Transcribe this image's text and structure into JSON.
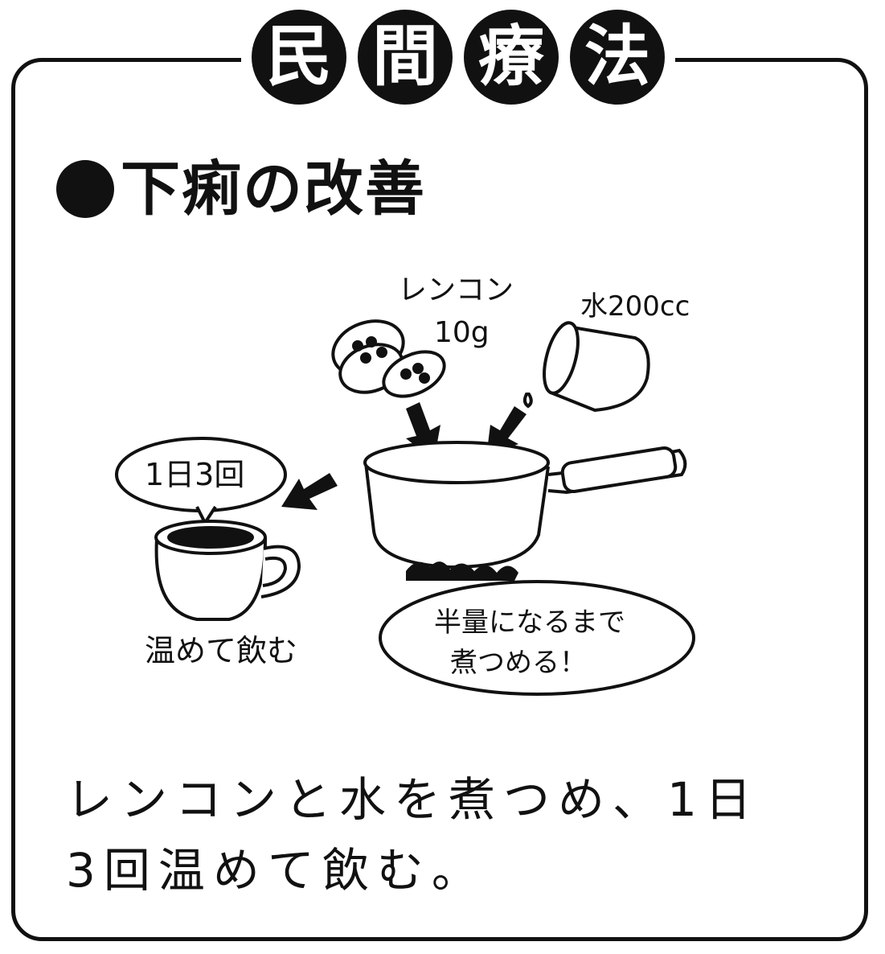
{
  "title": {
    "chars": [
      "民",
      "間",
      "療",
      "法"
    ]
  },
  "heading": "下痢の改善",
  "illustration": {
    "lotus_label": "レンコン",
    "lotus_amount": "10g",
    "water_label": "水200cc",
    "bubble_text": "1日3回",
    "cup_label": "温めて飲む",
    "pot_note_line1": "半量になるまで",
    "pot_note_line2": "煮つめる！"
  },
  "caption": {
    "line1": "レンコンと水を煮つめ、1日",
    "line2": "3回温めて飲む。"
  }
}
